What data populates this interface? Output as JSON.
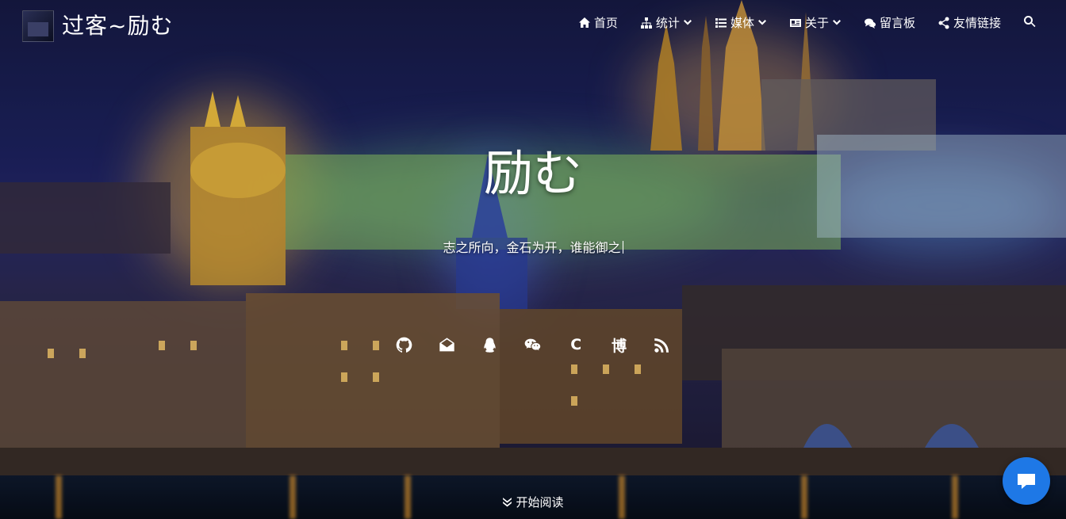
{
  "header": {
    "site_title": "过客~励む",
    "nav": [
      {
        "label": "首页",
        "icon": "home-icon"
      },
      {
        "label": "统计",
        "icon": "sitemap-icon",
        "dropdown": true
      },
      {
        "label": "媒体",
        "icon": "list-icon",
        "dropdown": true
      },
      {
        "label": "关于",
        "icon": "id-card-icon",
        "dropdown": true
      },
      {
        "label": "留言板",
        "icon": "comments-icon"
      },
      {
        "label": "友情链接",
        "icon": "share-icon"
      }
    ],
    "search_icon": "search-icon"
  },
  "hero": {
    "title": "励む",
    "subtitle": "志之所向，金石为开，谁能御之"
  },
  "social": [
    {
      "name": "github",
      "icon": "github-icon"
    },
    {
      "name": "email",
      "icon": "envelope-icon"
    },
    {
      "name": "qq",
      "icon": "qq-icon"
    },
    {
      "name": "wechat",
      "icon": "wechat-icon"
    },
    {
      "name": "csdn",
      "text": "C"
    },
    {
      "name": "blog",
      "text": "博"
    },
    {
      "name": "rss",
      "icon": "rss-icon"
    }
  ],
  "start_reading": "开始阅读",
  "colors": {
    "chat_button": "#1e78e6"
  }
}
